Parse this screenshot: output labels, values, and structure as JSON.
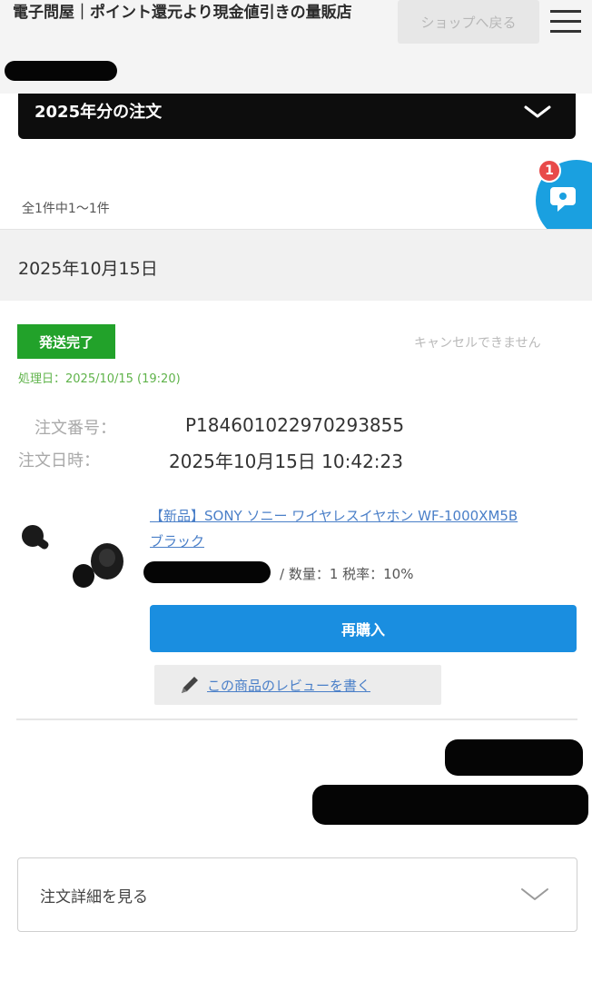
{
  "header": {
    "shop_title": "電子問屋｜ポイント還元より現金値引きの量販店",
    "back_button": "ショップへ戻る"
  },
  "year_selector": {
    "label": "2025年分の注文"
  },
  "chat": {
    "badge_count": "1"
  },
  "results": {
    "count_text": "全1件中1〜1件"
  },
  "order": {
    "date": "2025年10月15日",
    "status": "発送完了",
    "cancel_note": "キャンセルできません",
    "processed": "処理日：2025/10/15 (19:20)",
    "order_number_label": "注文番号：",
    "order_number": "P1846010229702938​55",
    "order_datetime_label": "注文日時：",
    "order_datetime": "2025年10月15日 10:42:23",
    "product": {
      "name": "【新品】SONY ソニー ワイヤレスイヤホン WF-1000XM5B ブラック",
      "qty_tax": "/ 数量：1 税率：10%"
    },
    "rebuy_button": "再購入",
    "review_link": "この商品のレビューを書く"
  },
  "details": {
    "label": "注文詳細を見る"
  },
  "colors": {
    "status_green": "#22a22a",
    "primary_blue": "#1a8ee0",
    "link_blue": "#4a7fc8",
    "chat_blue": "#1aa0e0",
    "badge_red": "#e84a4a"
  },
  "icons": [
    "menu-icon",
    "chevron-down-icon",
    "chat-icon",
    "pencil-icon",
    "earbuds-image"
  ]
}
